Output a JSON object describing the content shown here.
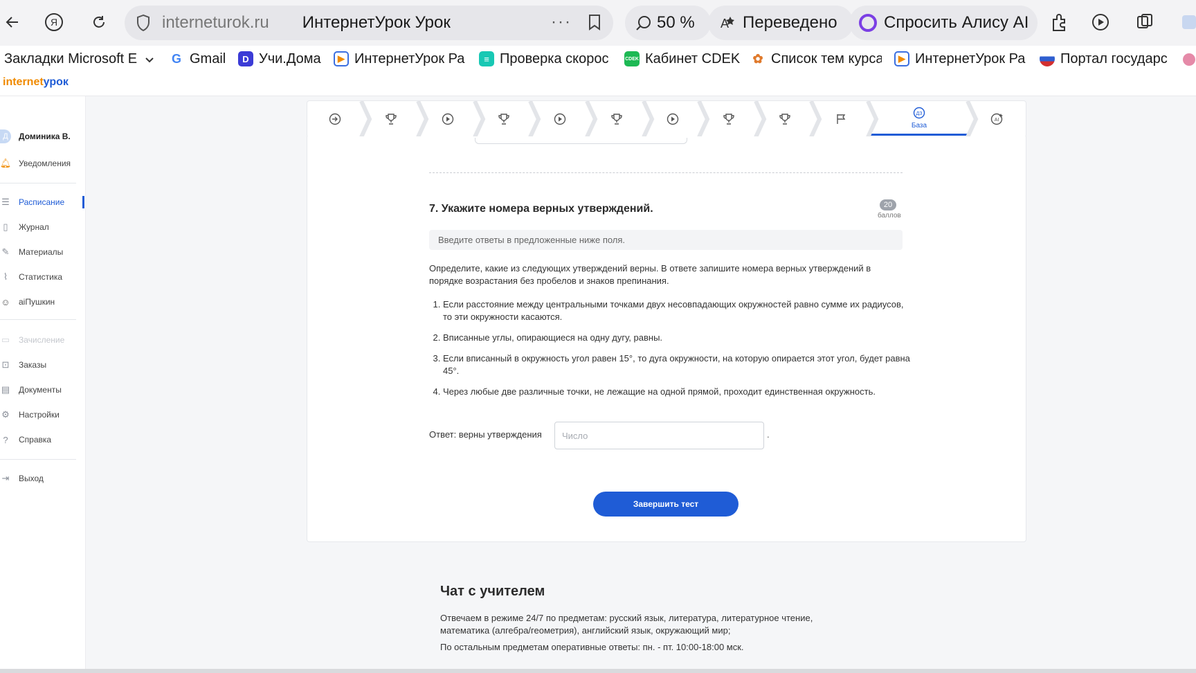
{
  "browser": {
    "address_domain": "interneturok.ru",
    "tab_title": "ИнтернетУрок Урок",
    "more_label": "···",
    "zoom": "50 %",
    "translated_label": "Переведено",
    "alice_label": "Спросить Алису AI"
  },
  "bookmarks": [
    {
      "label": "Закладки Microsoft E",
      "icon": "folder-icon"
    },
    {
      "label": "Gmail",
      "icon": "google-icon"
    },
    {
      "label": "Учи.Дома",
      "icon": "uchi-icon"
    },
    {
      "label": "ИнтернетУрок Ра",
      "icon": "play-icon"
    },
    {
      "label": "Проверка скорос",
      "icon": "speedtest-icon"
    },
    {
      "label": "Кабинет CDEK",
      "icon": "cdek-icon"
    },
    {
      "label": "Список тем курса",
      "icon": "list-icon"
    },
    {
      "label": "ИнтернетУрок Ра",
      "icon": "play-icon"
    },
    {
      "label": "Портал государс",
      "icon": "flag-icon"
    }
  ],
  "site": {
    "logo_a": "internet",
    "logo_b": "урок"
  },
  "sidebar": {
    "user": "Доминика В.",
    "items": [
      {
        "label": "Уведомления",
        "icon": "bell-icon"
      },
      {
        "label": "Расписание",
        "icon": "list-icon"
      },
      {
        "label": "Журнал",
        "icon": "journal-icon"
      },
      {
        "label": "Материалы",
        "icon": "materials-icon"
      },
      {
        "label": "Статистика",
        "icon": "stats-icon"
      },
      {
        "label": "aiПушкин",
        "icon": "robot-icon"
      },
      {
        "label": "Зачисление",
        "icon": "enroll-icon"
      },
      {
        "label": "Заказы",
        "icon": "cart-icon"
      },
      {
        "label": "Документы",
        "icon": "document-icon"
      },
      {
        "label": "Настройки",
        "icon": "gear-icon"
      },
      {
        "label": "Справка",
        "icon": "help-icon"
      },
      {
        "label": "Выход",
        "icon": "logout-icon"
      }
    ]
  },
  "steps": {
    "active_label": "База",
    "items": [
      "start-icon",
      "trophy-icon",
      "video-icon",
      "trophy-icon",
      "video-icon",
      "trophy-icon",
      "video-icon",
      "trophy-icon",
      "trophy-icon",
      "flag-icon",
      "homework-icon",
      "ai-icon"
    ]
  },
  "question": {
    "title": "7. Укажите номера верных утверждений.",
    "points": "20",
    "points_label": "баллов",
    "hint": "Введите ответы в предложенные ниже поля.",
    "intro": "Определите, какие из следующих утверждений верны. В ответе запишите номера верных утверждений в порядке возрастания без пробелов и знаков препинания.",
    "statements": [
      "Если расстояние между центральными точками двух несовпадающих окружностей равно сумме их радиусов, то эти окружности касаются.",
      "Вписанные углы, опирающиеся на одну дугу, равны.",
      "Если вписанный в окружность угол равен 15°, то дуга окружности, на которую опирается этот угол, будет равна 45°.",
      "Через любые две различные точки, не лежащие на одной прямой, проходит единственная окружность."
    ],
    "answer_label": "Ответ: верны утверждения",
    "answer_placeholder": "Число",
    "answer_value": "",
    "after": "."
  },
  "finish_button": "Завершить тест",
  "chat": {
    "title": "Чат с учителем",
    "p1": "Отвечаем в режиме 24/7 по предметам: русский язык, литература, литературное чтение, математика (алгебра/геометрия), английский язык, окружающий мир;",
    "p2": "По остальным предметам оперативные ответы: пн. - пт. 10:00-18:00 мск."
  },
  "colors": {
    "accent": "#1f5cd6",
    "orange": "#f08a00"
  }
}
